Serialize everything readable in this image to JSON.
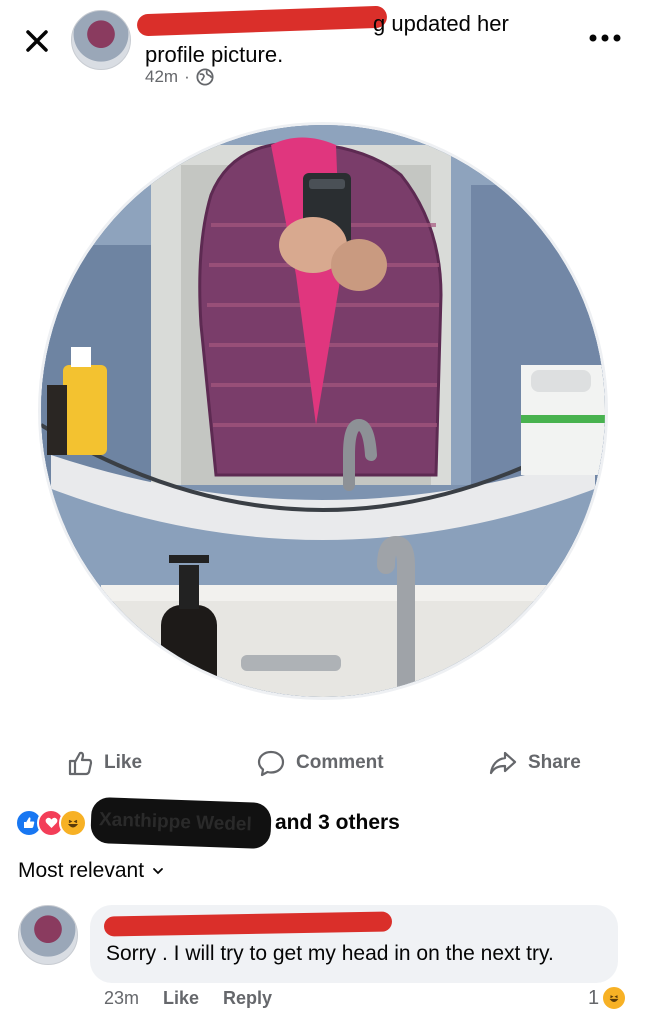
{
  "header": {
    "close_icon": "close-icon",
    "status_line1_visible": "g updated her",
    "status_line2": "profile picture.",
    "timestamp": "42m",
    "separator": "·",
    "privacy_icon": "globe-icon",
    "more_icon": "more-options-icon",
    "more_label": "•••"
  },
  "photo": {
    "alt": "profile-photo"
  },
  "actions": {
    "like_label": "Like",
    "comment_label": "Comment",
    "share_label": "Share"
  },
  "reactions": {
    "icons": [
      "like-reaction-icon",
      "love-reaction-icon",
      "haha-reaction-icon"
    ],
    "names_obscured": "Xanthippe Wedel",
    "and_others": "and 3 others"
  },
  "sort": {
    "label": "Most relevant",
    "chevron_icon": "chevron-down-icon"
  },
  "comment": {
    "text": "Sorry . I will try to get my head in on the next try.",
    "time": "23m",
    "like_label": "Like",
    "reply_label": "Reply",
    "reaction_count": "1",
    "reaction_icon": "haha-reaction-icon"
  },
  "colors": {
    "secondary_text": "#65676b",
    "bubble_bg": "#f0f2f5",
    "like_blue": "#1877f2",
    "love_red": "#f33e58",
    "haha_yellow": "#f7b125"
  }
}
